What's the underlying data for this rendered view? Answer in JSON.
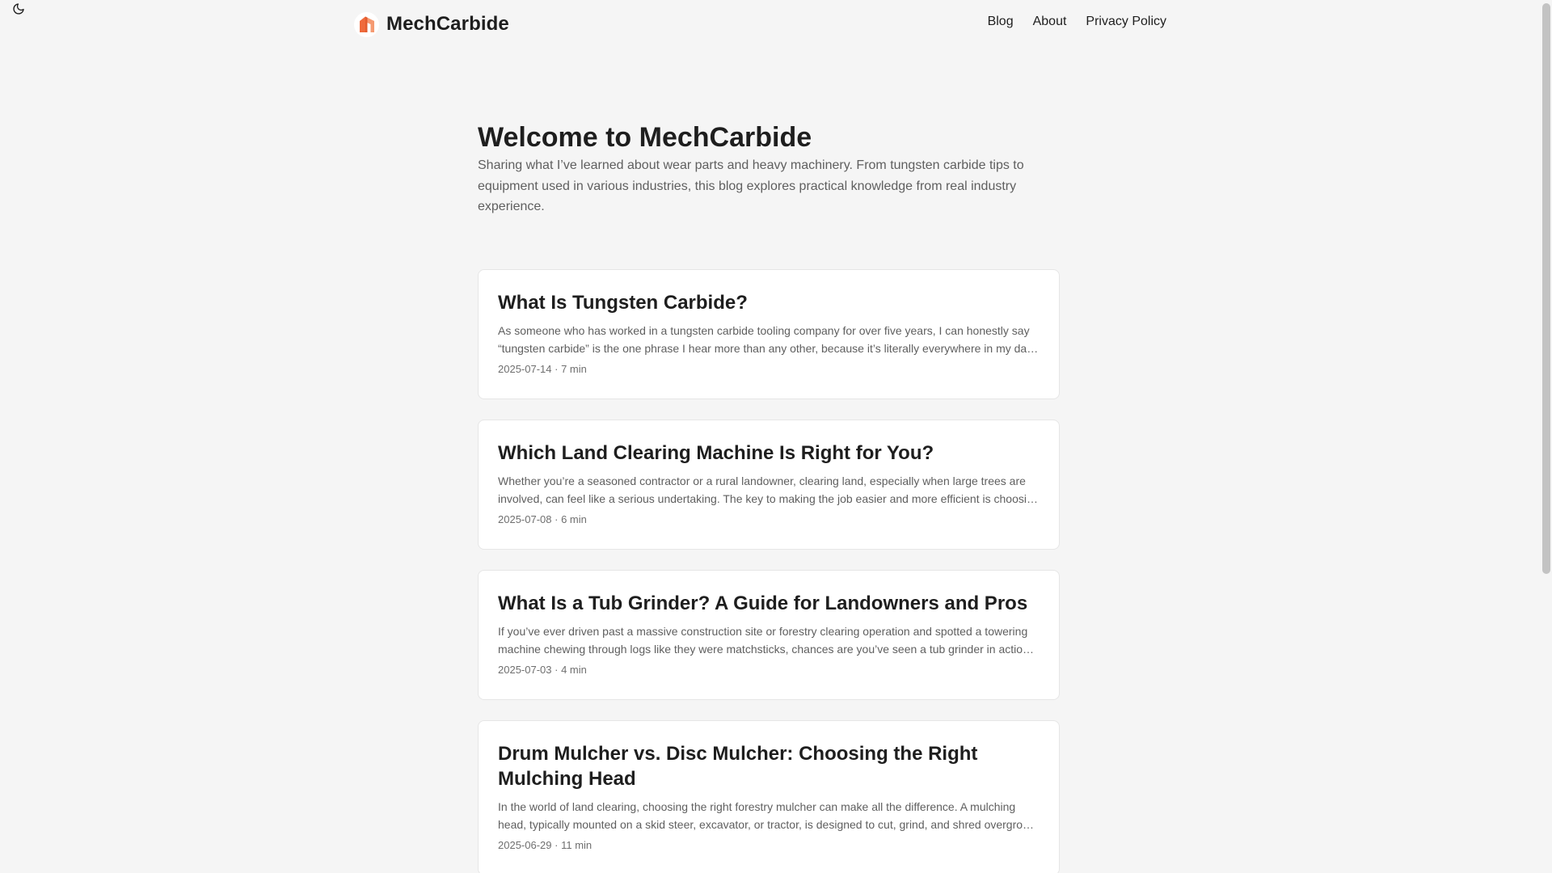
{
  "header": {
    "brand_name": "MechCarbide",
    "logo_icon": "carbide-bracket-logo",
    "theme_icon": "moon-icon",
    "nav": [
      {
        "label": "Blog"
      },
      {
        "label": "About"
      },
      {
        "label": "Privacy Policy"
      }
    ]
  },
  "intro": {
    "title": "Welcome to MechCarbide",
    "description": "Sharing what I’ve learned about wear parts and heavy machinery. From tungsten carbide tips to equipment used in various industries, this blog explores practical knowledge from real industry experience."
  },
  "posts": [
    {
      "title": "What Is Tungsten Carbide?",
      "excerpt": "As someone who has worked in a tungsten carbide tooling company for over five years, I can honestly say “tungsten carbide” is the one phrase I hear more than any other, because it’s literally everywhere in my da…",
      "date": "2025-07-14",
      "read_time": "7 min"
    },
    {
      "title": "Which Land Clearing Machine Is Right for You?",
      "excerpt": "Whether you’re a seasoned contractor or a rural landowner, clearing land, especially when large trees are involved, can feel like a serious undertaking. The key to making the job easier and more efficient is choosi…",
      "date": "2025-07-08",
      "read_time": "6 min"
    },
    {
      "title": "What Is a Tub Grinder? A Guide for Landowners and Pros",
      "excerpt": "If you’ve ever driven past a massive construction site or forestry clearing operation and spotted a towering machine chewing through logs like they were matchsticks, chances are you’ve seen a tub grinder in actio…",
      "date": "2025-07-03",
      "read_time": "4 min"
    },
    {
      "title": "Drum Mulcher vs. Disc Mulcher: Choosing the Right Mulching Head",
      "excerpt": "In the world of land clearing, choosing the right forestry mulcher can make all the difference. A mulching head, typically mounted on a skid steer, excavator, or tractor, is designed to cut, grind, and shred overgro…",
      "date": "2025-06-29",
      "read_time": "11 min"
    }
  ],
  "meta_separator": "·",
  "colors": {
    "background": "#f5f5f5",
    "card": "#ffffff",
    "logo_orange": "#ef6a3c",
    "text": "#1e1e1e",
    "muted": "#5f5f5f"
  }
}
